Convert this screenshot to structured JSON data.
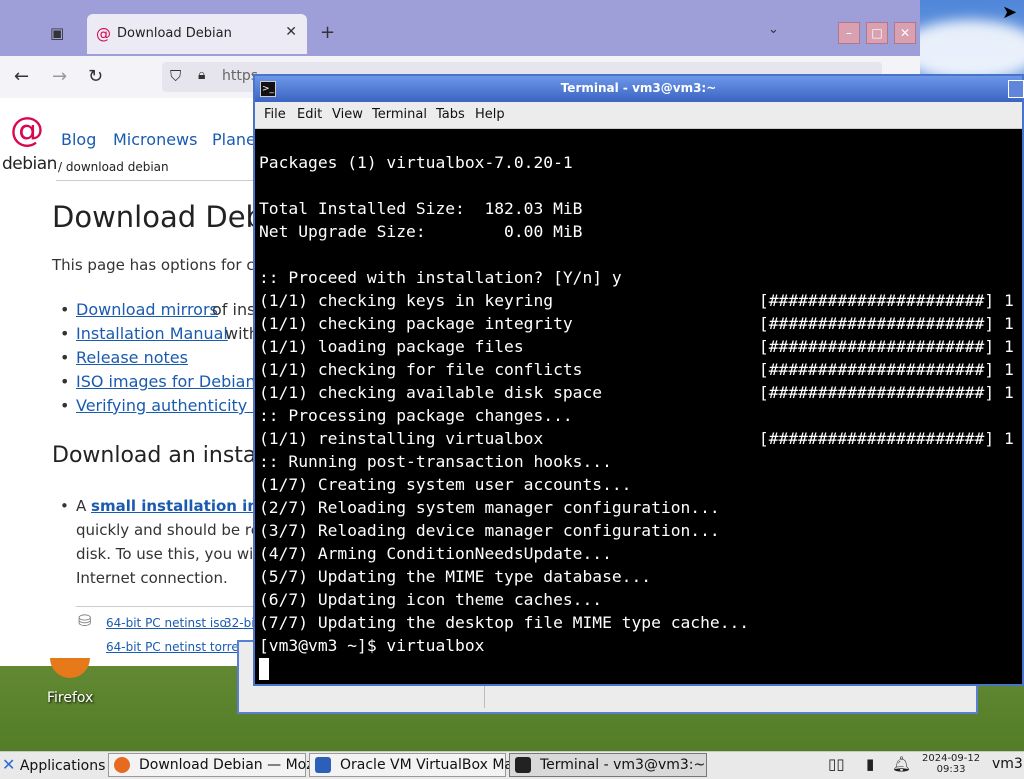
{
  "firefox": {
    "tab_title": "Download Debian",
    "url": "https",
    "logo_text": "debian",
    "nav": [
      "Blog",
      "Micronews",
      "Plane"
    ],
    "breadcrumb": "/ download debian",
    "heading": "Download Debi",
    "intro": "This page has options for c",
    "links": [
      {
        "link": "Download mirrors",
        "rest": "of ins"
      },
      {
        "link": "Installation Manual",
        "rest": "with"
      },
      {
        "link": "Release notes",
        "rest": ""
      },
      {
        "link": "ISO images for Debian t",
        "rest": ""
      },
      {
        "link": "Verifying authenticity of",
        "rest": ""
      }
    ],
    "subheading": "Download an instal",
    "install_text": {
      "prefix": "A ",
      "bold": "small installation im",
      "line2": "quickly and should be re",
      "line3": "disk. To use this, you wi",
      "line4": "Internet connection."
    },
    "downloads": [
      "64-bit PC netinst iso",
      "32-bit",
      "64-bit PC netinst torrents"
    ]
  },
  "desktop": {
    "icon_label": "Firefox"
  },
  "terminal": {
    "title": "Terminal - vm3@vm3:~",
    "menu": [
      "File",
      "Edit",
      "View",
      "Terminal",
      "Tabs",
      "Help"
    ],
    "lines": [
      "",
      "Packages (1) virtualbox-7.0.20-1",
      "",
      "Total Installed Size:  182.03 MiB",
      "Net Upgrade Size:        0.00 MiB",
      "",
      ":: Proceed with installation? [Y/n] y",
      "(1/1) checking keys in keyring                     [######################] 1",
      "(1/1) checking package integrity                   [######################] 1",
      "(1/1) loading package files                        [######################] 1",
      "(1/1) checking for file conflicts                  [######################] 1",
      "(1/1) checking available disk space                [######################] 1",
      ":: Processing package changes...",
      "(1/1) reinstalling virtualbox                      [######################] 1",
      ":: Running post-transaction hooks...",
      "(1/7) Creating system user accounts...",
      "(2/7) Reloading system manager configuration...",
      "(3/7) Reloading device manager configuration...",
      "(4/7) Arming ConditionNeedsUpdate...",
      "(5/7) Updating the MIME type database...",
      "(6/7) Updating icon theme caches...",
      "(7/7) Updating the desktop file MIME type cache...",
      "[vm3@vm3 ~]$ virtualbox"
    ]
  },
  "taskbar": {
    "applications": "Applications",
    "tasks": [
      {
        "label": "Download Debian — Moz...",
        "icon_color": "#e66a1f"
      },
      {
        "label": "Oracle VM VirtualBox Ma...",
        "icon_color": "#2b5fb8"
      },
      {
        "label": "Terminal - vm3@vm3:~",
        "icon_color": "#222222"
      }
    ],
    "date": "2024-09-12",
    "time": "09:33",
    "user": "vm3"
  }
}
